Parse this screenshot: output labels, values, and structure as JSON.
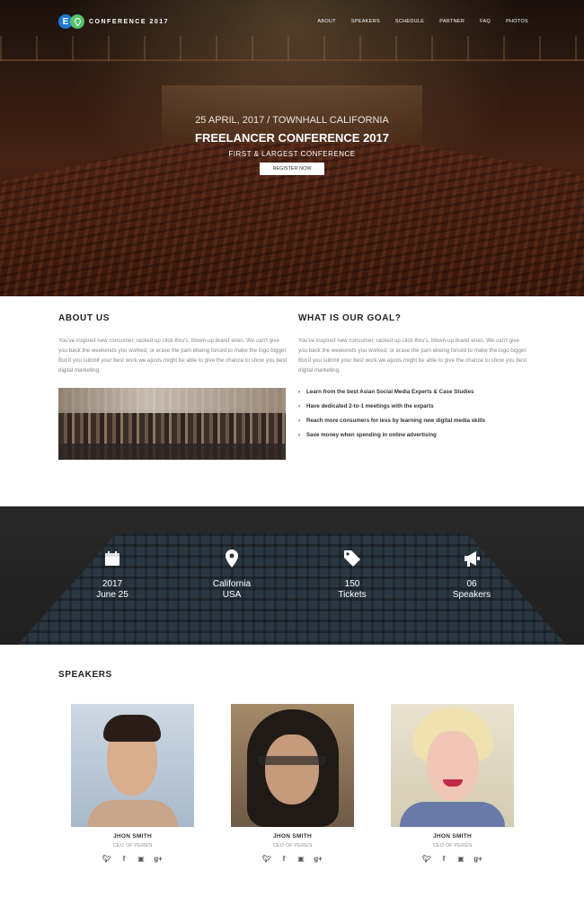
{
  "nav": {
    "logo_letter": "E",
    "brand": "CONFERENCE 2017",
    "items": [
      "ABOUT",
      "SPEAKERS",
      "SCHEDULE",
      "PARTNER",
      "FAQ",
      "PHOTOS"
    ]
  },
  "hero": {
    "date_location": "25 APRIL, 2017 / TOWNHALL CALIFORNIA",
    "title": "FREELANCER CONFERENCE 2017",
    "subtitle": "FIRST & LARGEST CONFERENCE",
    "register_label": "REGISTER NOW"
  },
  "about": {
    "heading": "ABOUT US",
    "text": "You've inspired new consumer, racked up click-thru's, blown-up brand enes. We can't give you back the weekends you worked, or erase the pain ebeing forced to make the logo bigger. But if you submit your best work we ajusts might be able to give the chance to show you best digital marketing."
  },
  "goal": {
    "heading": "WHAT IS OUR GOAL?",
    "text": "You've inspired new consumer, racked up click-thru's, blown-up brand enes. We can't give you back the weekends you worked, or erase the pain ebeing forced to make the logo bigger. But if you submit your best work we ajusts might be able to give the chance to show you best digital marketing.",
    "bullets": [
      "Learn from the best Asian Social Media Experts & Case Studies",
      "Have dedicated 2-to-1 meetings with the exparts",
      "Reach more consumers for less by learning new digital media skills",
      "Save money when spending in online advertising"
    ]
  },
  "stats": [
    {
      "icon": "calendar-icon",
      "line1": "2017",
      "line2": "June 25"
    },
    {
      "icon": "map-pin-icon",
      "line1": "California",
      "line2": "USA"
    },
    {
      "icon": "tag-icon",
      "line1": "150",
      "line2": "Tickets"
    },
    {
      "icon": "megaphone-icon",
      "line1": "06",
      "line2": "Speakers"
    }
  ],
  "speakers": {
    "heading": "SPEAKERS",
    "items": [
      {
        "name": "JHON SMITH",
        "role": "CEO OF PEREN"
      },
      {
        "name": "JHON SMITH",
        "role": "CEO OF PEREN"
      },
      {
        "name": "JHON SMITH",
        "role": "CEO OF PEREN"
      }
    ],
    "social": [
      "twitter-icon",
      "facebook-icon",
      "linkedin-icon",
      "google-plus-icon"
    ]
  }
}
